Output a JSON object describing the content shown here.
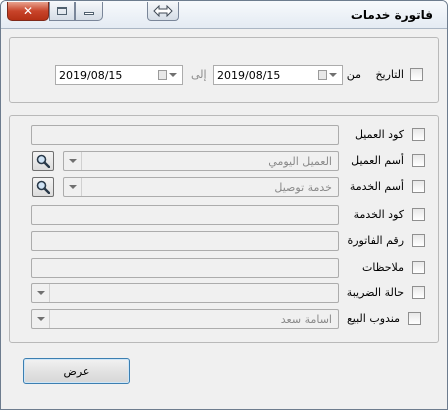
{
  "window": {
    "title": "فاتورة خدمات"
  },
  "date_filter": {
    "label": "التاريخ",
    "from_label": "من",
    "to_label": "إلى",
    "from_value": "2019/08/15",
    "to_value": "2019/08/15"
  },
  "fields": {
    "customer_code": {
      "label": "كود العميل"
    },
    "customer_name": {
      "label": "أسم العميل",
      "value": "العميل اليومي"
    },
    "service_name": {
      "label": "أسم الخدمة",
      "value": "خدمة توصيل"
    },
    "service_code": {
      "label": "كود الخدمة"
    },
    "invoice_number": {
      "label": "رقم الفاتورة"
    },
    "notes": {
      "label": "ملاحظات"
    },
    "tax_status": {
      "label": "حالة الضريبة",
      "value": ""
    },
    "sales_rep": {
      "label": "مندوب البيع",
      "value": "اسامة سعد"
    }
  },
  "actions": {
    "show_label": "عرض"
  },
  "icons": {
    "close": "close-icon",
    "maximize": "maximize-icon",
    "minimize": "minimize-icon",
    "resize": "resize-arrows-icon",
    "search": "magnifier-icon",
    "dropdown": "chevron-down-icon",
    "calendar": "calendar-icon"
  }
}
